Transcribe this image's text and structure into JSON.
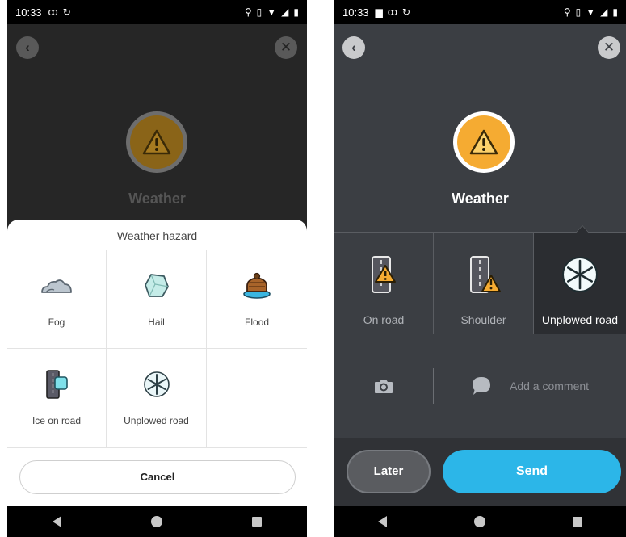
{
  "left": {
    "status": {
      "time": "10:33"
    },
    "title": "Weather",
    "sheet": {
      "title": "Weather hazard",
      "items": [
        {
          "label": "Fog",
          "icon": "fog-icon"
        },
        {
          "label": "Hail",
          "icon": "hail-icon"
        },
        {
          "label": "Flood",
          "icon": "flood-icon"
        },
        {
          "label": "Ice on road",
          "icon": "ice-on-road-icon"
        },
        {
          "label": "Unplowed road",
          "icon": "unplowed-road-icon"
        }
      ],
      "cancel_label": "Cancel"
    }
  },
  "right": {
    "status": {
      "time": "10:33"
    },
    "title": "Weather",
    "options": [
      {
        "label": "On road",
        "icon": "on-road-icon",
        "selected": false
      },
      {
        "label": "Shoulder",
        "icon": "shoulder-icon",
        "selected": false
      },
      {
        "label": "Unplowed road",
        "icon": "snowflake-icon",
        "selected": true
      }
    ],
    "comment_placeholder": "Add a comment",
    "later_label": "Later",
    "send_label": "Send"
  },
  "colors": {
    "warning_accent": "#f5ab32",
    "send_button": "#2cb6e8",
    "dimmed_accent": "#8a6418"
  }
}
